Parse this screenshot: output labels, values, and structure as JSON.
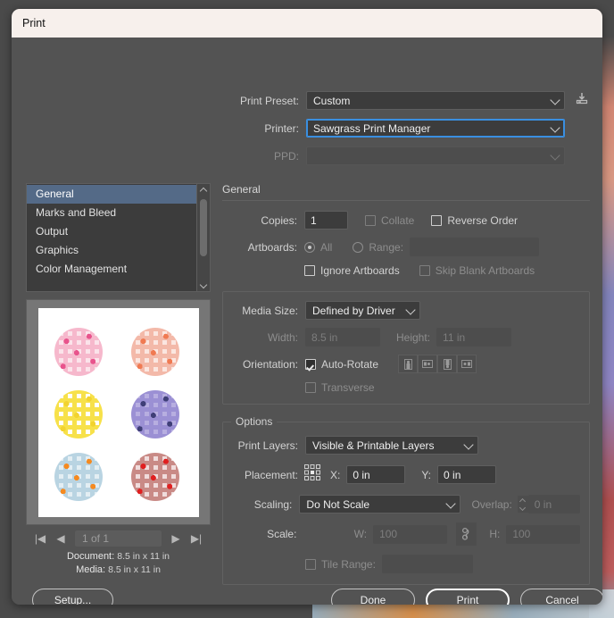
{
  "window": {
    "title": "Print"
  },
  "top": {
    "print_preset_label": "Print Preset:",
    "print_preset_value": "Custom",
    "save_preset_icon": "save-preset-icon",
    "printer_label": "Printer:",
    "printer_value": "Sawgrass Print Manager",
    "ppd_label": "PPD:",
    "ppd_value": ""
  },
  "sidebar": {
    "items": [
      {
        "label": "General",
        "selected": true
      },
      {
        "label": "Marks and Bleed",
        "selected": false
      },
      {
        "label": "Output",
        "selected": false
      },
      {
        "label": "Graphics",
        "selected": false
      },
      {
        "label": "Color Management",
        "selected": false
      }
    ]
  },
  "preview": {
    "nav": {
      "first": "|◀",
      "prev": "◀",
      "page_value": "1 of 1",
      "next": "▶",
      "last": "▶|"
    },
    "document_label": "Document:",
    "document_value": "8.5 in x 11 in",
    "media_label": "Media:",
    "media_value": "8.5 in x 11 in",
    "swatches": [
      {
        "name": "strawberry-gingham",
        "bg": "#fbe3ea",
        "check": "#f6b8cc",
        "dot": "#e8538c"
      },
      {
        "name": "peach-gingham",
        "bg": "#fbe6e0",
        "check": "#f3b9a9",
        "dot": "#f07a52"
      },
      {
        "name": "banana-grid",
        "bg": "#ffffff",
        "check": "#f7e14a",
        "dot": "#f2d32f"
      },
      {
        "name": "blueberry-gingham",
        "bg": "#b7aee0",
        "check": "#9b90d4",
        "dot": "#3f3f77"
      },
      {
        "name": "orange-gingham",
        "bg": "#e3eef3",
        "check": "#b9d4e2",
        "dot": "#f58a20"
      },
      {
        "name": "cherry-gingham",
        "bg": "#f0dcdc",
        "check": "#c98a86",
        "dot": "#e01f20"
      }
    ]
  },
  "general": {
    "section_title": "General",
    "copies_label": "Copies:",
    "copies_value": "1",
    "collate_label": "Collate",
    "collate_checked": false,
    "reverse_order_label": "Reverse Order",
    "reverse_order_checked": false,
    "artboards_label": "Artboards:",
    "all_label": "All",
    "all_selected": true,
    "range_label": "Range:",
    "range_value": "",
    "ignore_artboards_label": "Ignore Artboards",
    "ignore_artboards_checked": false,
    "skip_blank_label": "Skip Blank Artboards",
    "skip_blank_checked": false
  },
  "media": {
    "media_size_label": "Media Size:",
    "media_size_value": "Defined by Driver",
    "width_label": "Width:",
    "width_value": "8.5 in",
    "height_label": "Height:",
    "height_value": "11 in",
    "orientation_label": "Orientation:",
    "auto_rotate_label": "Auto-Rotate",
    "auto_rotate_checked": true,
    "orientation_buttons": [
      "orientation-portrait-icon",
      "orientation-landscape-icon",
      "orientation-portrait-reverse-icon",
      "orientation-landscape-reverse-icon"
    ],
    "transverse_label": "Transverse",
    "transverse_checked": false
  },
  "options": {
    "section_title": "Options",
    "print_layers_label": "Print Layers:",
    "print_layers_value": "Visible & Printable Layers",
    "placement_label": "Placement:",
    "placement_icon": "placement-anchor-grid-icon",
    "x_label": "X:",
    "x_value": "0 in",
    "y_label": "Y:",
    "y_value": "0 in",
    "scaling_label": "Scaling:",
    "scaling_value": "Do Not Scale",
    "overlap_label": "Overlap:",
    "overlap_value": "0 in",
    "scale_label": "Scale:",
    "scale_w_label": "W:",
    "scale_w_value": "100",
    "link_icon": "link-chain-icon",
    "scale_h_label": "H:",
    "scale_h_value": "100",
    "tile_range_label": "Tile Range:",
    "tile_range_value": "",
    "tile_range_checked": false
  },
  "footer": {
    "setup_label": "Setup...",
    "done_label": "Done",
    "print_label": "Print",
    "cancel_label": "Cancel"
  },
  "colors": {
    "dialog_bg": "#535353",
    "titlebar_bg": "#f7f0ec",
    "focus_blue": "#3a8fe0",
    "selection_blue": "#546a87"
  }
}
